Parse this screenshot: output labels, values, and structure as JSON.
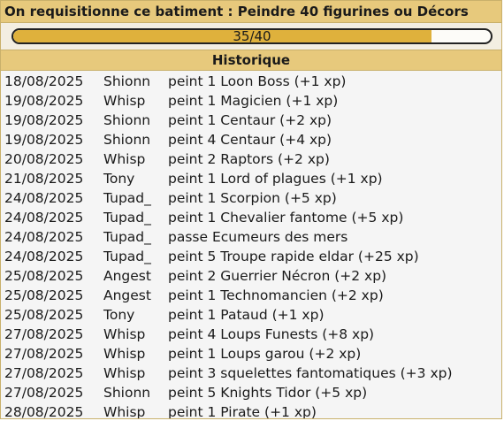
{
  "title": "On requisitionne ce batiment : Peindre 40 figurines ou Décors",
  "progress": {
    "current": 35,
    "total": 40,
    "label": "35/40",
    "fraction": 0.875
  },
  "history": {
    "header": "Historique",
    "rows": [
      {
        "date": "18/08/2025",
        "user": "Shionn",
        "action": "peint 1 Loon Boss (+1 xp)"
      },
      {
        "date": "19/08/2025",
        "user": "Whisp",
        "action": "peint 1 Magicien (+1 xp)"
      },
      {
        "date": "19/08/2025",
        "user": "Shionn",
        "action": "peint 1 Centaur (+2 xp)"
      },
      {
        "date": "19/08/2025",
        "user": "Shionn",
        "action": "peint 4 Centaur (+4 xp)"
      },
      {
        "date": "20/08/2025",
        "user": "Whisp",
        "action": "peint 2 Raptors (+2 xp)"
      },
      {
        "date": "21/08/2025",
        "user": "Tony",
        "action": "peint 1 Lord of plagues (+1 xp)"
      },
      {
        "date": "24/08/2025",
        "user": "Tupad_",
        "action": "peint 1 Scorpion (+5 xp)"
      },
      {
        "date": "24/08/2025",
        "user": "Tupad_",
        "action": "peint 1 Chevalier fantome (+5 xp)"
      },
      {
        "date": "24/08/2025",
        "user": "Tupad_",
        "action": "passe Ecumeurs des mers"
      },
      {
        "date": "24/08/2025",
        "user": "Tupad_",
        "action": "peint 5 Troupe rapide eldar (+25 xp)"
      },
      {
        "date": "25/08/2025",
        "user": "Angest",
        "action": "peint 2 Guerrier Nécron (+2 xp)"
      },
      {
        "date": "25/08/2025",
        "user": "Angest",
        "action": "peint 1 Technomancien (+2 xp)"
      },
      {
        "date": "25/08/2025",
        "user": "Tony",
        "action": "peint 1 Pataud (+1 xp)"
      },
      {
        "date": "27/08/2025",
        "user": "Whisp",
        "action": "peint 4 Loups Funests (+8 xp)"
      },
      {
        "date": "27/08/2025",
        "user": "Whisp",
        "action": "peint 1 Loups garou (+2 xp)"
      },
      {
        "date": "27/08/2025",
        "user": "Whisp",
        "action": "peint 3 squelettes fantomatiques (+3 xp)"
      },
      {
        "date": "27/08/2025",
        "user": "Shionn",
        "action": "peint 5 Knights Tidor (+5 xp)"
      },
      {
        "date": "28/08/2025",
        "user": "Whisp",
        "action": "peint 1 Pirate (+1 xp)"
      }
    ]
  },
  "colors": {
    "header_bg": "#e7c97c",
    "progress_fill": "#dfb13c",
    "border": "#c9b06b"
  }
}
